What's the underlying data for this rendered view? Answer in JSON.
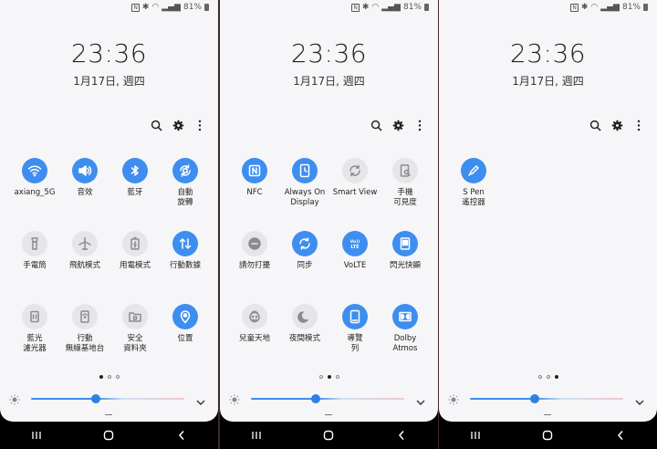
{
  "status": {
    "battery": "81%"
  },
  "clock": {
    "time": "23:36",
    "date": "1月17日, 週四"
  },
  "pages": [
    {
      "tiles": [
        {
          "label": "axiang_5G",
          "icon": "wifi-icon",
          "on": true
        },
        {
          "label": "音效",
          "icon": "sound-icon",
          "on": true
        },
        {
          "label": "藍牙",
          "icon": "bluetooth-icon",
          "on": true
        },
        {
          "label": "自動\n旋轉",
          "icon": "auto-rotate-icon",
          "on": true
        },
        {
          "label": "手電筒",
          "icon": "flashlight-icon",
          "on": false
        },
        {
          "label": "飛航模式",
          "icon": "airplane-icon",
          "on": false
        },
        {
          "label": "用電模式",
          "icon": "power-mode-icon",
          "on": false
        },
        {
          "label": "行動數據",
          "icon": "mobile-data-icon",
          "on": true
        },
        {
          "label": "藍光\n濾光器",
          "icon": "blue-light-filter-icon",
          "on": false
        },
        {
          "label": "行動\n無線基地台",
          "icon": "mobile-hotspot-icon",
          "on": false
        },
        {
          "label": "安全\n資料夾",
          "icon": "secure-folder-icon",
          "on": false
        },
        {
          "label": "位置",
          "icon": "location-icon",
          "on": true
        }
      ]
    },
    {
      "tiles": [
        {
          "label": "NFC",
          "icon": "nfc-icon",
          "on": true
        },
        {
          "label": "Always On\nDisplay",
          "icon": "always-on-display-icon",
          "on": true
        },
        {
          "label": "Smart View",
          "icon": "smart-view-icon",
          "on": false
        },
        {
          "label": "手機\n可見度",
          "icon": "phone-visibility-icon",
          "on": false
        },
        {
          "label": "請勿打擾",
          "icon": "do-not-disturb-icon",
          "on": false
        },
        {
          "label": "同步",
          "icon": "sync-icon",
          "on": true
        },
        {
          "label": "VoLTE",
          "icon": "volte-icon",
          "on": true
        },
        {
          "label": "閃光快顯",
          "icon": "flash-notification-icon",
          "on": true
        },
        {
          "label": "兒童天地",
          "icon": "kids-home-icon",
          "on": false
        },
        {
          "label": "夜間模式",
          "icon": "night-mode-icon",
          "on": false
        },
        {
          "label": "導覽\n列",
          "icon": "navigation-bar-icon",
          "on": true
        },
        {
          "label": "Dolby\nAtmos",
          "icon": "dolby-atmos-icon",
          "on": true
        }
      ]
    },
    {
      "tiles": [
        {
          "label": "S Pen\n遙控器",
          "icon": "s-pen-icon",
          "on": true
        }
      ]
    }
  ],
  "brightness": {
    "level": 0.42
  },
  "colors": {
    "accent": "#3e8ef0",
    "off_tile": "#e6e6e8",
    "panel": "#f6f6f8"
  }
}
